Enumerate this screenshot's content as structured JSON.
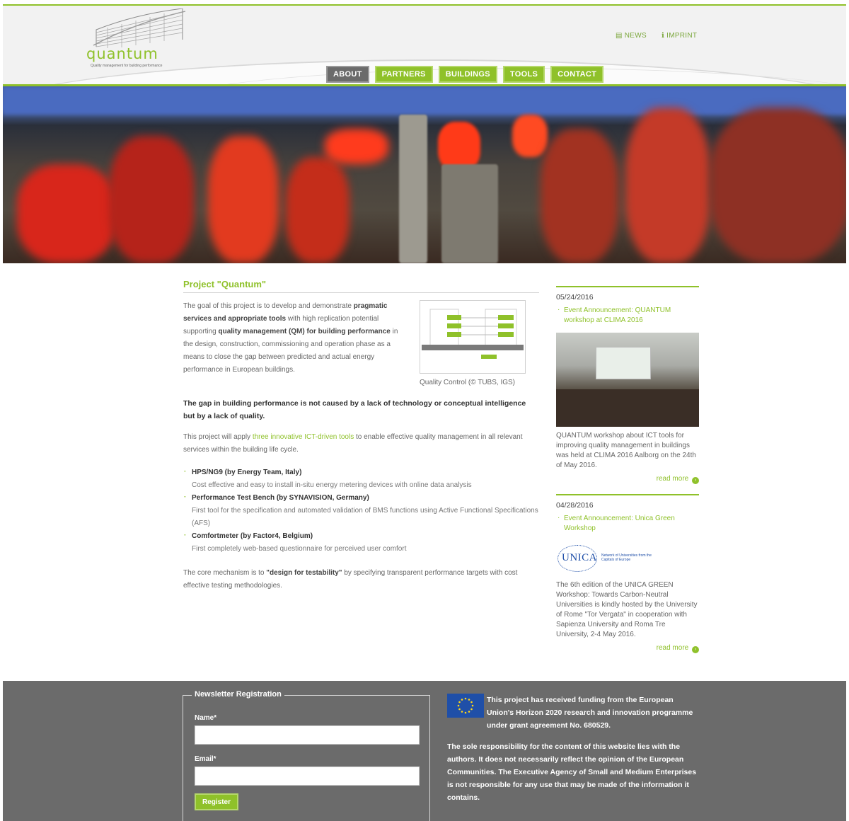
{
  "site": {
    "logo_text": "quantum",
    "logo_tagline": "Quality management for building performance"
  },
  "utility": {
    "news_label": "NEWS",
    "imprint_label": "IMPRINT"
  },
  "nav": {
    "items": [
      {
        "label": "ABOUT",
        "active": true
      },
      {
        "label": "PARTNERS",
        "active": false
      },
      {
        "label": "BUILDINGS",
        "active": false
      },
      {
        "label": "TOOLS",
        "active": false
      },
      {
        "label": "CONTACT",
        "active": false
      }
    ]
  },
  "main": {
    "title": "Project \"Quantum\"",
    "intro_1": "The goal of this project is to develop and demonstrate ",
    "intro_b1": "pragmatic services and appropriate tools",
    "intro_2": " with high replication potential supporting ",
    "intro_b2": "quality management (QM) for building performance",
    "intro_3": " in the design, construction, commissioning and operation phase as a means to close the gap between predicted and actual energy performance in European buildings.",
    "figure_caption": "Quality Control (© TUBS, IGS)",
    "gap_statement": "The gap in building performance is not caused by a lack of technology or conceptual intelligence but by a lack of quality.",
    "apply_1": "This project will apply ",
    "apply_link": "three innovative ICT-driven tools",
    "apply_2": " to enable effective quality management in all relevant services within the building life cycle.",
    "tools": [
      {
        "name": "HPS/NG9 (by Energy Team, Italy)",
        "desc": "Cost effective and easy to install in-situ energy metering devices with online data analysis"
      },
      {
        "name": "Performance Test Bench (by SYNAVISION, Germany)",
        "desc": "First tool for the specification and automated validation of BMS functions using Active Functional Specifications (AFS)"
      },
      {
        "name": "Comfortmeter (by Factor4, Belgium)",
        "desc": "First completely web-based questionnaire for perceived user comfort"
      }
    ],
    "core_1": "The core mechanism is to ",
    "core_b": "\"design for testability\"",
    "core_2": " by specifying transparent performance targets with cost effective testing methodologies."
  },
  "sidebar": {
    "news": [
      {
        "date": "05/24/2016",
        "title": "Event Announcement: QUANTUM workshop at CLIMA 2016",
        "text": "QUANTUM workshop about ICT tools for improving quality management in buildings was held at CLIMA 2016 Aalborg on the 24th of May 2016.",
        "read_more": "read more"
      },
      {
        "date": "04/28/2016",
        "title": "Event Announcement: Unica Green Workshop",
        "logo_text": "UNICA",
        "logo_sub": "Network of Universities from the Capitals of Europe",
        "text": "The 6th edition of the UNICA GREEN Workshop: Towards Carbon-Neutral Universities is kindly hosted by the University of Rome \"Tor Vergata\" in cooperation with Sapienza University and Roma Tre University, 2-4 May 2016.",
        "read_more": "read more"
      }
    ]
  },
  "footer": {
    "newsletter": {
      "legend": "Newsletter Registration",
      "name_label": "Name*",
      "name_value": "",
      "email_label": "Email*",
      "email_value": "",
      "register_label": "Register"
    },
    "eu_funding": "This project has received funding from the European Union's Horizon 2020 research and innovation programme under grant agreement No. 680529.",
    "disclaimer": "The sole responsibility for the content of this website lies with the authors. It does not necessarily reflect the opinion of the European Communities. The Executive Agency of Small and Medium Enterprises is not responsible for any use that may be made of the information it contains."
  },
  "colors": {
    "accent": "#8fc12a",
    "nav_active": "#6b6b6b",
    "footer_bg": "#6b6b6b"
  }
}
